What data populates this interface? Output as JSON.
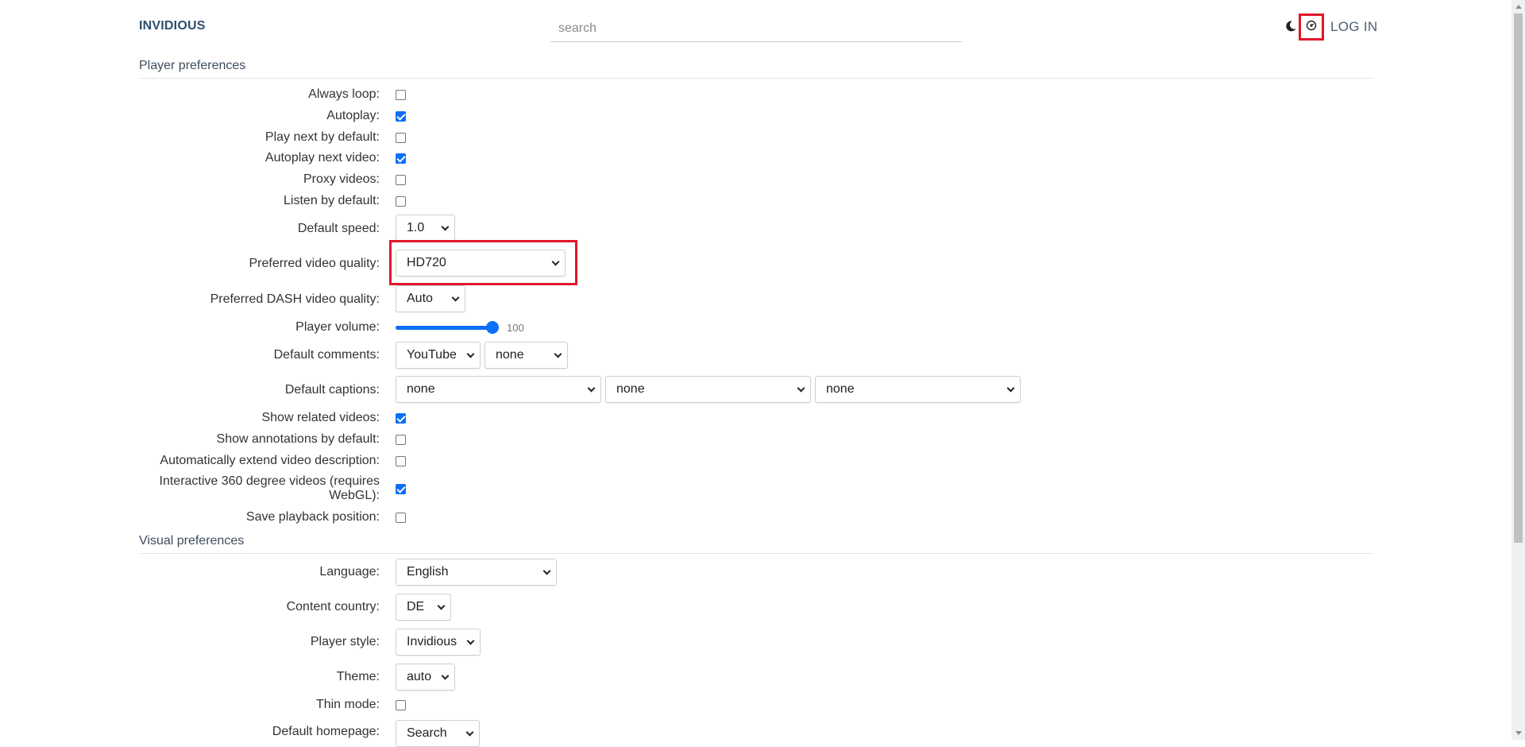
{
  "header": {
    "logo": "INVIDIOUS",
    "search_placeholder": "search",
    "login": "LOG IN"
  },
  "player_section": {
    "title": "Player preferences"
  },
  "player": {
    "always_loop": {
      "label": "Always loop:",
      "checked": false
    },
    "autoplay": {
      "label": "Autoplay:",
      "checked": true
    },
    "play_next": {
      "label": "Play next by default:",
      "checked": false
    },
    "autoplay_next": {
      "label": "Autoplay next video:",
      "checked": true
    },
    "proxy_videos": {
      "label": "Proxy videos:",
      "checked": false
    },
    "listen": {
      "label": "Listen by default:",
      "checked": false
    },
    "speed": {
      "label": "Default speed:",
      "value": "1.0"
    },
    "quality": {
      "label": "Preferred video quality:",
      "value": "HD720"
    },
    "dash_quality": {
      "label": "Preferred DASH video quality:",
      "value": "Auto"
    },
    "volume": {
      "label": "Player volume:",
      "value": "100"
    },
    "comments": {
      "label": "Default comments:",
      "value1": "YouTube",
      "value2": "none"
    },
    "captions": {
      "label": "Default captions:",
      "value1": "none",
      "value2": "none",
      "value3": "none"
    },
    "related": {
      "label": "Show related videos:",
      "checked": true
    },
    "annotations": {
      "label": "Show annotations by default:",
      "checked": false
    },
    "extend_desc": {
      "label": "Automatically extend video description:",
      "checked": false
    },
    "vr360": {
      "label": "Interactive 360 degree videos (requires WebGL):",
      "checked": true
    },
    "save_position": {
      "label": "Save playback position:",
      "checked": false
    }
  },
  "visual_section": {
    "title": "Visual preferences"
  },
  "visual": {
    "language": {
      "label": "Language:",
      "value": "English"
    },
    "country": {
      "label": "Content country:",
      "value": "DE"
    },
    "player_style": {
      "label": "Player style:",
      "value": "Invidious"
    },
    "theme": {
      "label": "Theme:",
      "value": "auto"
    },
    "thin_mode": {
      "label": "Thin mode:",
      "checked": false
    },
    "homepage": {
      "label": "Default homepage:",
      "value": "Search"
    }
  },
  "colors": {
    "accent": "#0b6ff7",
    "highlight": "#e3162a",
    "logo": "#2c4e6e"
  }
}
